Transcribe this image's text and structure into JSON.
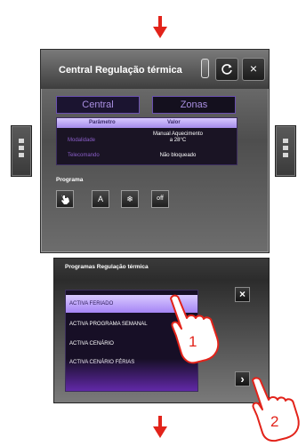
{
  "header": {
    "title": "Central Regulação térmica",
    "refresh_icon": "refresh-icon",
    "close_icon": "close-icon",
    "close_label": "×"
  },
  "tabs": [
    {
      "label": "Central",
      "active": true
    },
    {
      "label": "Zonas",
      "active": false
    }
  ],
  "status_table": {
    "headers": [
      "Parâmetro",
      "Valor"
    ],
    "rows": [
      {
        "label": "Modalidade",
        "value_line1": "Manual Aquecimento",
        "value_line2": "a 28°C"
      },
      {
        "label": "Teleco­mando",
        "value_line1": "Não bloqueado",
        "value_line2": ""
      }
    ]
  },
  "program": {
    "label": "Programa",
    "buttons": [
      {
        "name": "manual-hand-icon",
        "label": ""
      },
      {
        "name": "auto",
        "label": "A"
      },
      {
        "name": "snowflake-icon",
        "label": "❄"
      },
      {
        "name": "off",
        "label": "off"
      }
    ]
  },
  "programs_panel": {
    "title": "Programas Regulação térmica",
    "items": [
      {
        "label": "ACTIVA FERIADO",
        "selected": true
      },
      {
        "label": "ACTIVA PROGRAMA SEMANAL",
        "selected": false
      },
      {
        "label": "ACTIVA CENÁRIO",
        "selected": false
      },
      {
        "label": "ACTIVA CENÁRIO FÉRIAS",
        "selected": false
      }
    ],
    "close_label": "×",
    "next_label": "›"
  },
  "callouts": [
    "1",
    "2"
  ],
  "colors": {
    "arrow": "#e2231a",
    "accent_purple": "#a88ee0",
    "selected_row": "#c3a8ff"
  }
}
